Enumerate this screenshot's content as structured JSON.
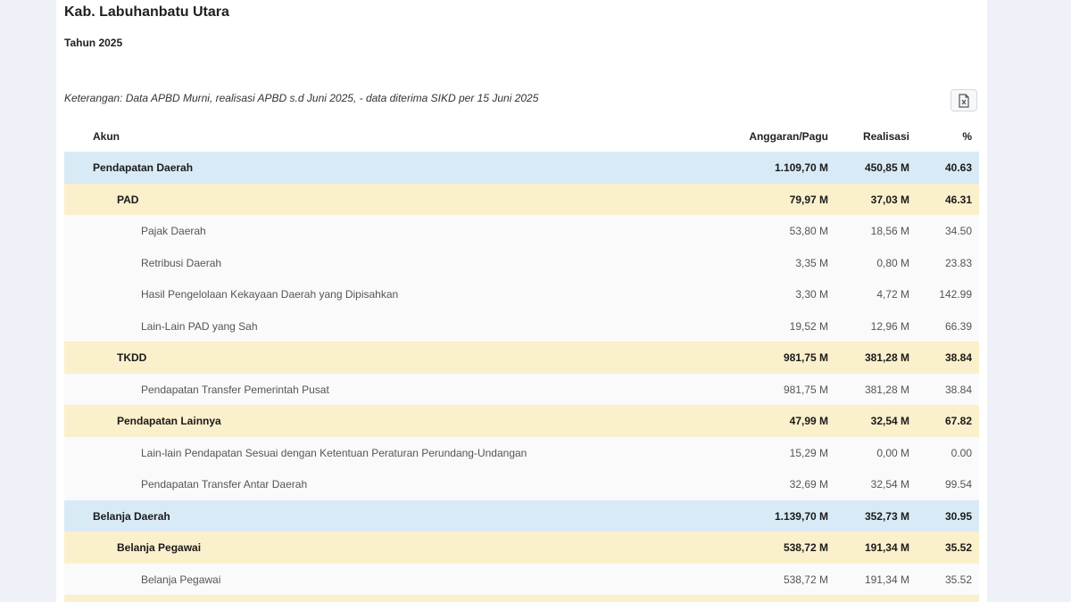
{
  "header": {
    "region": "Kab. Labuhanbatu Utara",
    "year": "Tahun 2025",
    "note": "Keterangan: Data APBD Murni, realisasi APBD s.d Juni 2025, - data diterima SIKD per 15 Juni 2025"
  },
  "toolbar": {
    "export_icon": "excel-export-icon"
  },
  "table": {
    "columns": {
      "account": "Akun",
      "budget": "Anggaran/Pagu",
      "realization": "Realisasi",
      "percent": "%"
    },
    "rows": [
      {
        "level": 1,
        "name": "Pendapatan Daerah",
        "budget": "1.109,70 M",
        "realization": "450,85 M",
        "percent": "40.63"
      },
      {
        "level": 2,
        "name": "PAD",
        "budget": "79,97 M",
        "realization": "37,03 M",
        "percent": "46.31"
      },
      {
        "level": 3,
        "name": "Pajak Daerah",
        "budget": "53,80 M",
        "realization": "18,56 M",
        "percent": "34.50"
      },
      {
        "level": 3,
        "name": "Retribusi Daerah",
        "budget": "3,35 M",
        "realization": "0,80 M",
        "percent": "23.83"
      },
      {
        "level": 3,
        "name": "Hasil Pengelolaan Kekayaan Daerah yang Dipisahkan",
        "budget": "3,30 M",
        "realization": "4,72 M",
        "percent": "142.99"
      },
      {
        "level": 3,
        "name": "Lain-Lain PAD yang Sah",
        "budget": "19,52 M",
        "realization": "12,96 M",
        "percent": "66.39"
      },
      {
        "level": 2,
        "name": "TKDD",
        "budget": "981,75 M",
        "realization": "381,28 M",
        "percent": "38.84"
      },
      {
        "level": 3,
        "name": "Pendapatan Transfer Pemerintah Pusat",
        "budget": "981,75 M",
        "realization": "381,28 M",
        "percent": "38.84"
      },
      {
        "level": 2,
        "name": "Pendapatan Lainnya",
        "budget": "47,99 M",
        "realization": "32,54 M",
        "percent": "67.82"
      },
      {
        "level": 3,
        "name": "Lain-lain Pendapatan Sesuai dengan Ketentuan Peraturan Perundang-Undangan",
        "budget": "15,29 M",
        "realization": "0,00 M",
        "percent": "0.00"
      },
      {
        "level": 3,
        "name": "Pendapatan Transfer Antar Daerah",
        "budget": "32,69 M",
        "realization": "32,54 M",
        "percent": "99.54"
      },
      {
        "level": 1,
        "name": "Belanja Daerah",
        "budget": "1.139,70 M",
        "realization": "352,73 M",
        "percent": "30.95"
      },
      {
        "level": 2,
        "name": "Belanja Pegawai",
        "budget": "538,72 M",
        "realization": "191,34 M",
        "percent": "35.52"
      },
      {
        "level": 3,
        "name": "Belanja Pegawai",
        "budget": "538,72 M",
        "realization": "191,34 M",
        "percent": "35.52"
      },
      {
        "level": 2,
        "name": "",
        "budget": "",
        "realization": "",
        "percent": ""
      }
    ]
  },
  "colors": {
    "level1_bg": "#d9eaf7",
    "level2_bg": "#fbf0cc",
    "page_bg": "#eef1f7"
  }
}
